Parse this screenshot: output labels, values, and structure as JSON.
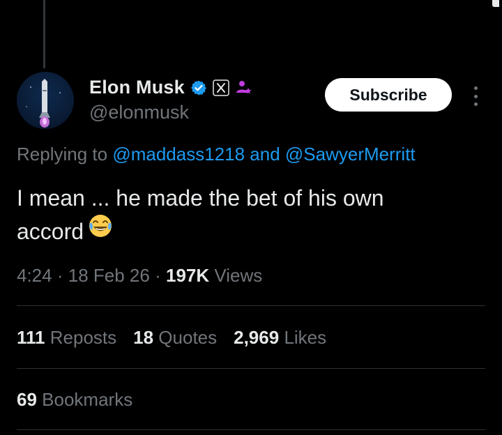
{
  "author": {
    "name": "Elon Musk",
    "handle": "@elonmusk",
    "icons": [
      "verified-badge-icon",
      "x-affiliate-icon",
      "subscriber-person-icon"
    ]
  },
  "subscribe_label": "Subscribe",
  "reply": {
    "prefix": "Replying to",
    "mention1": "@maddass1218",
    "conjunction": "and",
    "mention2": "@SawyerMerritt"
  },
  "tweet": {
    "line1": "I mean ... he made the bet of his own",
    "line2": "accord",
    "emoji": "face-with-tears-of-joy"
  },
  "meta": {
    "time": "4:24",
    "date": "18 Feb 26",
    "separator": "·",
    "views_count": "197K",
    "views_label": "Views"
  },
  "stats": {
    "reposts_count": "111",
    "reposts_label": "Reposts",
    "quotes_count": "18",
    "quotes_label": "Quotes",
    "likes_count": "2,969",
    "likes_label": "Likes",
    "bookmarks_count": "69",
    "bookmarks_label": "Bookmarks"
  },
  "colors": {
    "background": "#000000",
    "text": "#e7e9ea",
    "muted": "#71767b",
    "link": "#1d9bf0",
    "verified": "#1d9bf0"
  }
}
